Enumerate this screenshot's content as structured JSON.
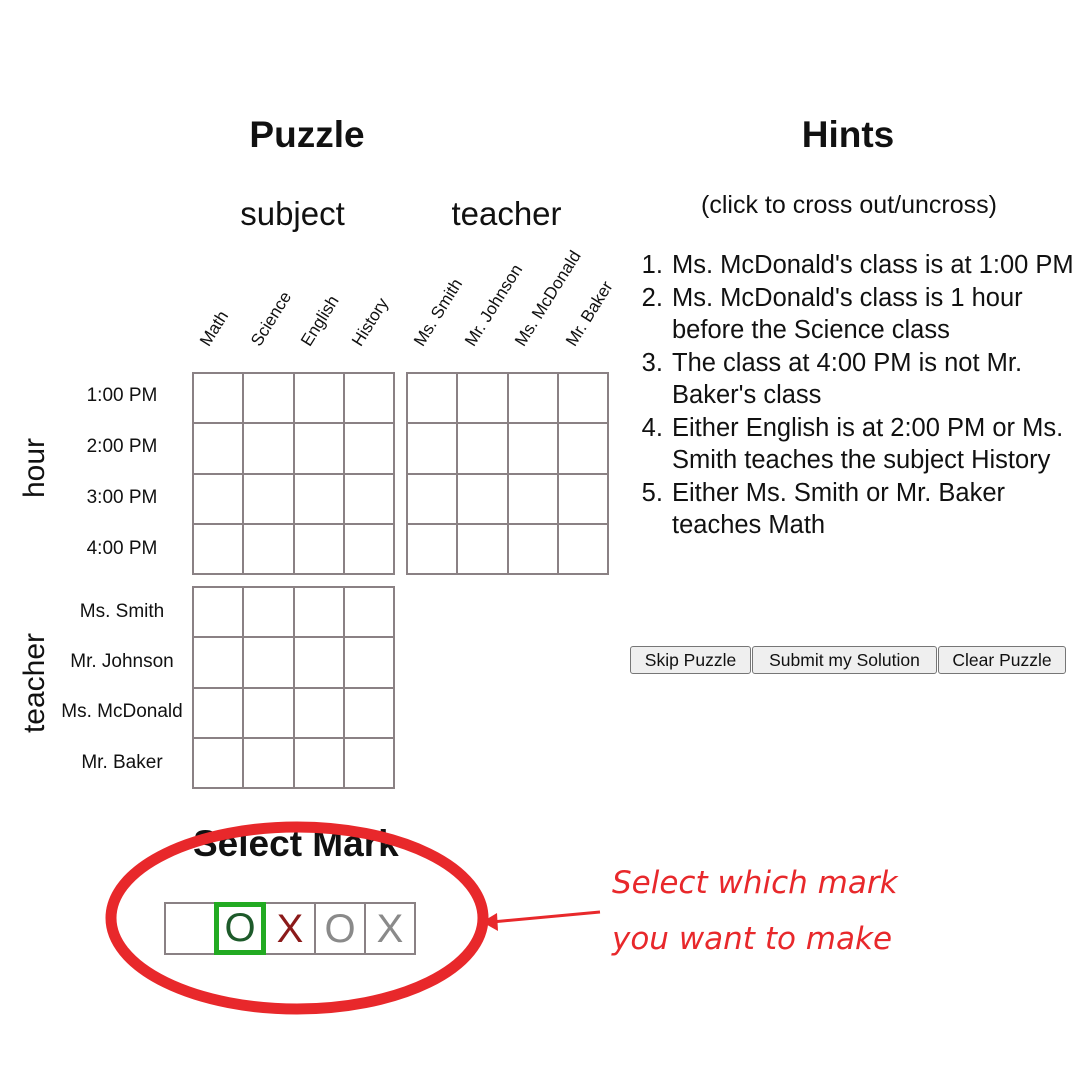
{
  "puzzle": {
    "title": "Puzzle",
    "groups": {
      "subject": "subject",
      "teacher": "teacher"
    },
    "subjects": [
      "Math",
      "Science",
      "English",
      "History"
    ],
    "teachers": [
      "Ms. Smith",
      "Mr. Johnson",
      "Ms. McDonald",
      "Mr. Baker"
    ],
    "hours": [
      "1:00 PM",
      "2:00 PM",
      "3:00 PM",
      "4:00 PM"
    ],
    "axis": {
      "hour": "hour",
      "teacher": "teacher"
    }
  },
  "hints": {
    "title": "Hints",
    "subtitle": "(click to cross out/uncross)",
    "items": [
      "Ms. McDonald's class is at 1:00 PM",
      "Ms. McDonald's class is 1 hour before the Science class",
      "The class at 4:00 PM is not Mr. Baker's class",
      "Either English is at 2:00 PM or Ms. Smith teaches the subject History",
      "Either Ms. Smith or Mr. Baker teaches Math"
    ]
  },
  "buttons": {
    "skip": "Skip Puzzle",
    "submit": "Submit my Solution",
    "clear": "Clear Puzzle"
  },
  "select_mark": {
    "title": "Select Mark",
    "marks": [
      {
        "symbol": "",
        "color": "#333333",
        "selected": false
      },
      {
        "symbol": "O",
        "color": "#1d5a2a",
        "selected": true
      },
      {
        "symbol": "X",
        "color": "#8b1a1a",
        "selected": false
      },
      {
        "symbol": "O",
        "color": "#8a8a8a",
        "selected": false
      },
      {
        "symbol": "X",
        "color": "#8a8a8a",
        "selected": false
      }
    ]
  },
  "annotation": {
    "line1": "Select which mark",
    "line2": "you want to make",
    "color": "#e8282b"
  },
  "colors": {
    "grid_border": "#8a8184",
    "selected_border": "#22aa22"
  }
}
